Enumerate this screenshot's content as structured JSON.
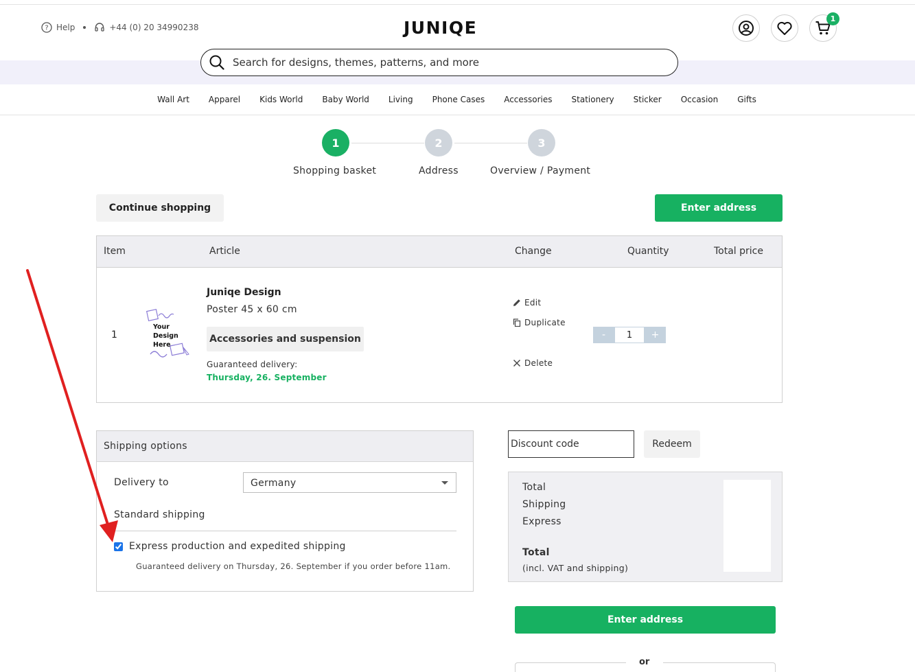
{
  "header": {
    "help_label": "Help",
    "phone": "+44 (0) 20 34990238",
    "logo": "JUNIQE",
    "cart_count": "1",
    "icons": [
      "help-icon",
      "headset-icon",
      "account-icon",
      "heart-icon",
      "cart-icon"
    ]
  },
  "search": {
    "placeholder": "Search for designs, themes, patterns, and more"
  },
  "nav": {
    "items": [
      "Wall Art",
      "Apparel",
      "Kids World",
      "Baby World",
      "Living",
      "Phone Cases",
      "Accessories",
      "Stationery",
      "Sticker",
      "Occasion",
      "Gifts"
    ]
  },
  "steps": [
    {
      "number": "1",
      "label": "Shopping basket",
      "color": "#1ab064"
    },
    {
      "number": "2",
      "label": "Address",
      "color": "#cfd5dc"
    },
    {
      "number": "3",
      "label": "Overview / Payment",
      "color": "#cfd5dc"
    }
  ],
  "buttons": {
    "continue_shopping": "Continue shopping",
    "enter_address": "Enter address",
    "redeem": "Redeem"
  },
  "cart": {
    "columns": [
      "Item",
      "Article",
      "Change",
      "Quantity",
      "Total price"
    ],
    "row": {
      "number": "1",
      "thumb_text": [
        "Your",
        "Design",
        "Here"
      ],
      "title": "Juniqe Design",
      "size": "Poster 45 x 60 cm",
      "accessories": "Accessories and suspension",
      "delivery_label": "Guaranteed delivery:",
      "delivery_date": "Thursday, 26. September",
      "actions": {
        "edit": "Edit",
        "duplicate": "Duplicate",
        "delete": "Delete"
      },
      "quantity": "1",
      "minus": "-",
      "plus": "+"
    }
  },
  "shipping": {
    "title": "Shipping options",
    "delivery_to_label": "Delivery to",
    "country": "Germany",
    "standard": "Standard shipping",
    "express_label": "Express production and expedited shipping",
    "express_checked": true,
    "express_note": "Guaranteed delivery on Thursday, 26. September if you order before 11am."
  },
  "discount": {
    "placeholder": "Discount code"
  },
  "totals": {
    "total": "Total",
    "shipping": "Shipping",
    "express": "Express",
    "grand_total": "Total",
    "grand_note": "(incl. VAT and shipping)"
  },
  "or_label": "or",
  "colors": {
    "brand_green": "#17b161",
    "annotation_red": "#e02020"
  }
}
